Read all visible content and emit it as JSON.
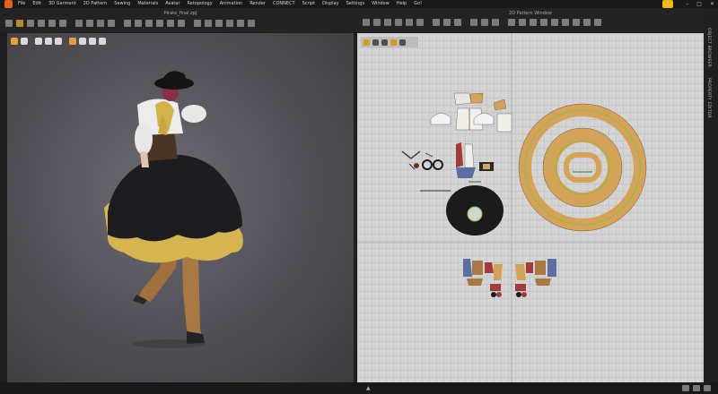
{
  "app": {
    "menu": [
      "File",
      "Edit",
      "3D Garment",
      "2D Pattern",
      "Sewing",
      "Materials",
      "Avatar",
      "Retopology",
      "Animation",
      "Render",
      "CONNECT",
      "Script",
      "Display",
      "Settings",
      "Window",
      "Help",
      "Go!"
    ],
    "window_controls": [
      "–",
      "□",
      "✕"
    ],
    "accent_color": "#e0621f"
  },
  "viewport_3d": {
    "title": "Pirate_final.zpj"
  },
  "window_2d": {
    "title": "2D Pattern Window"
  },
  "side_panel": {
    "tabs": [
      "OBJECT BROWSER",
      "PROPERTY EDITOR"
    ]
  },
  "colors": {
    "fabric_tan": "#d4a35a",
    "fabric_black": "#1c1c1c",
    "seam_green": "#7fbf3f",
    "grid_bg": "#d4d4d4"
  },
  "status": {
    "arrow": "▲"
  }
}
